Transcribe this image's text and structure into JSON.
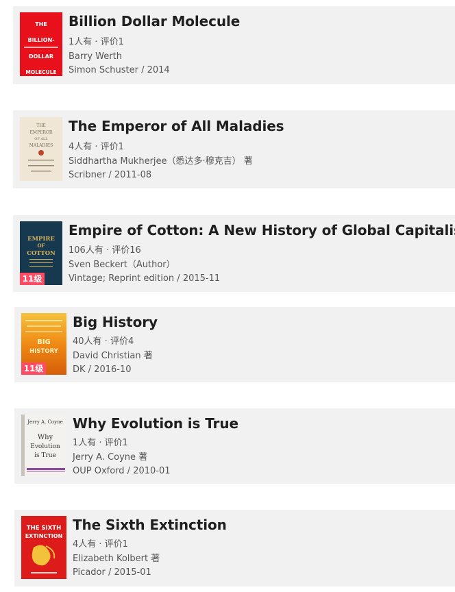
{
  "books": [
    {
      "title": "Billion Dollar Molecule",
      "stats": "1人有 · 评价1",
      "author": "Barry Werth",
      "publisher": "Simon Schuster / 2014",
      "cover_icon": "billion-dollar-molecule-cover",
      "cover_color": "#e8101a",
      "cover_lines": [
        "THE",
        "BILLION-",
        "DOLLAR",
        "MOLECULE"
      ],
      "badge": ""
    },
    {
      "title": "The Emperor of All Maladies",
      "stats": "4人有 · 评价1",
      "author": "Siddhartha Mukherjee（悉达多·穆克吉） 著",
      "publisher": "Scribner / 2011-08",
      "cover_icon": "emperor-of-all-maladies-cover",
      "cover_color": "#efe6d6",
      "cover_lines": [
        "THE",
        "EMPEROR",
        "OF ALL",
        "MALADIES"
      ],
      "badge": ""
    },
    {
      "title": "Empire of Cotton: A New History of Global Capitalism",
      "stats": "106人有 · 评价16",
      "author": "Sven Beckert（Author）",
      "publisher": "Vintage; Reprint edition / 2015-11",
      "cover_icon": "empire-of-cotton-cover",
      "cover_color": "#17394f",
      "cover_lines": [
        "EMPIRE",
        "OF",
        "COTTON"
      ],
      "badge": "11级"
    },
    {
      "title": "Big History",
      "stats": "40人有 · 评价4",
      "author": "David Christian 著",
      "publisher": "DK / 2016-10",
      "cover_icon": "big-history-cover",
      "cover_color": "#f2a21a",
      "cover_lines": [
        "BIG",
        "HISTORY"
      ],
      "badge": "11级"
    },
    {
      "title": "Why Evolution is True",
      "stats": "1人有 · 评价1",
      "author": "Jerry A. Coyne 著",
      "publisher": "OUP Oxford / 2010-01",
      "cover_icon": "why-evolution-is-true-cover",
      "cover_color": "#f4f2ee",
      "cover_lines": [
        "Jerry A. Coyne",
        "Why",
        "Evolution",
        "is True"
      ],
      "badge": ""
    },
    {
      "title": "The Sixth Extinction",
      "stats": "4人有 · 评价1",
      "author": "Elizabeth Kolbert 著",
      "publisher": "Picador / 2015-01",
      "cover_icon": "sixth-extinction-cover",
      "cover_color": "#dd1b1b",
      "cover_lines": [
        "THE SIXTH",
        "EXTINCTION"
      ],
      "badge": ""
    }
  ]
}
